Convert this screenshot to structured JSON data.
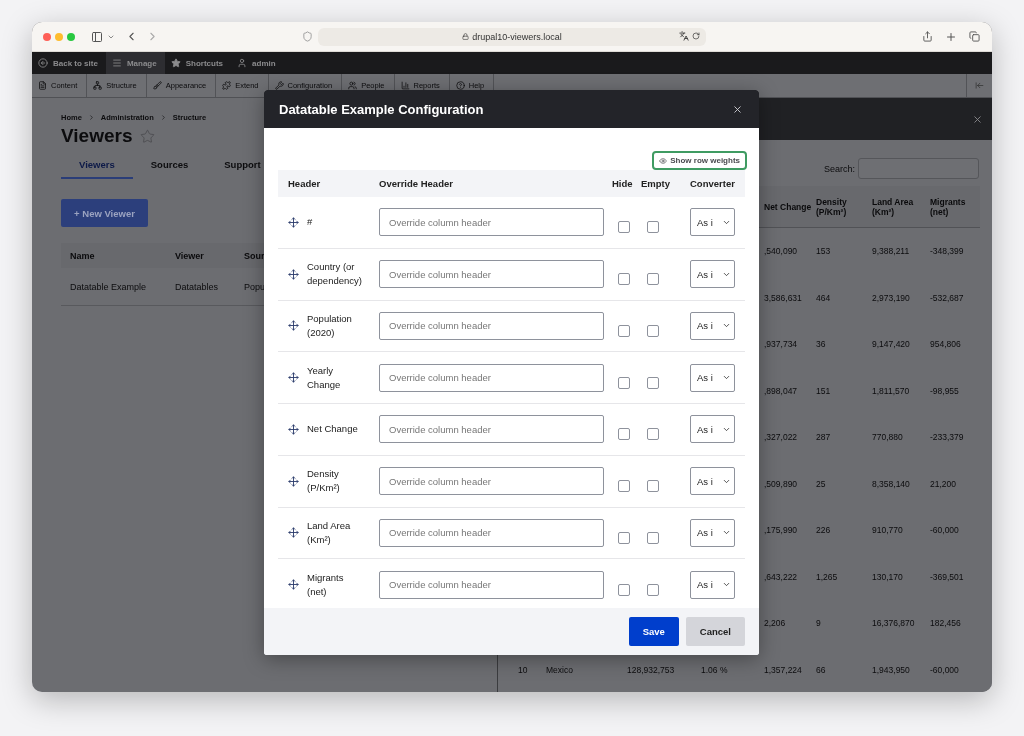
{
  "browser": {
    "url": "drupal10-viewers.local"
  },
  "admin_toolbar": {
    "items": [
      {
        "label": "Back to site",
        "kind": "back",
        "selected": false
      },
      {
        "label": "Manage",
        "kind": "menu",
        "selected": true
      },
      {
        "label": "Shortcuts",
        "kind": "star",
        "selected": false
      },
      {
        "label": "admin",
        "kind": "user",
        "selected": false
      }
    ]
  },
  "admin_menu": {
    "items": [
      {
        "label": "Content",
        "kind": "content"
      },
      {
        "label": "Structure",
        "kind": "structure"
      },
      {
        "label": "Appearance",
        "kind": "appearance"
      },
      {
        "label": "Extend",
        "kind": "extend"
      },
      {
        "label": "Configuration",
        "kind": "configuration"
      },
      {
        "label": "People",
        "kind": "people"
      },
      {
        "label": "Reports",
        "kind": "reports"
      },
      {
        "label": "Help",
        "kind": "help"
      }
    ]
  },
  "page": {
    "breadcrumb": [
      "Home",
      "Administration",
      "Structure"
    ],
    "title": "Viewers",
    "tabs": [
      {
        "label": "Viewers",
        "selected": true
      },
      {
        "label": "Sources",
        "selected": false
      },
      {
        "label": "Support",
        "selected": false
      }
    ],
    "new_button": "+ New Viewer",
    "table": {
      "columns": [
        "Name",
        "Viewer",
        "Sour"
      ],
      "rows": [
        [
          "Datatable Example",
          "Datatables",
          "Popu"
        ]
      ]
    }
  },
  "preview_dialog": {
    "search_label": "Search:",
    "columns": [
      "Net Change",
      "Density (P/Km²)",
      "Land Area (Km²)",
      "Migrants (net)"
    ],
    "rows": [
      {
        "net_change": ",540,090",
        "density": "153",
        "land_area": "9,388,211",
        "migrants": "-348,399"
      },
      {
        "net_change": "3,586,631",
        "density": "464",
        "land_area": "2,973,190",
        "migrants": "-532,687"
      },
      {
        "net_change": ",937,734",
        "density": "36",
        "land_area": "9,147,420",
        "migrants": "954,806"
      },
      {
        "net_change": ",898,047",
        "density": "151",
        "land_area": "1,811,570",
        "migrants": "-98,955"
      },
      {
        "net_change": ",327,022",
        "density": "287",
        "land_area": "770,880",
        "migrants": "-233,379"
      },
      {
        "net_change": ",509,890",
        "density": "25",
        "land_area": "8,358,140",
        "migrants": "21,200"
      },
      {
        "net_change": ",175,990",
        "density": "226",
        "land_area": "910,770",
        "migrants": "-60,000"
      },
      {
        "net_change": ",643,222",
        "density": "1,265",
        "land_area": "130,170",
        "migrants": "-369,501"
      },
      {
        "net_change": "2,206",
        "density": "9",
        "land_area": "16,376,870",
        "migrants": "182,456"
      },
      {
        "rank": "10",
        "country": "Mexico",
        "population": "128,932,753",
        "yearly_change": "1.06 %",
        "net_change": "1,357,224",
        "density": "66",
        "land_area": "1,943,950",
        "migrants": "-60,000"
      }
    ]
  },
  "config_dialog": {
    "title": "Datatable Example Configuration",
    "show_weights_button": "Show row weights",
    "columns": [
      "Header",
      "Override Header",
      "Hide",
      "Empty",
      "Converter"
    ],
    "rows": [
      {
        "header": "#",
        "placeholder": "Override column header",
        "hide": false,
        "empty": false,
        "converter": "As i"
      },
      {
        "header": "Country (or dependency)",
        "placeholder": "Override column header",
        "hide": false,
        "empty": false,
        "converter": "As i"
      },
      {
        "header": "Population (2020)",
        "placeholder": "Override column header",
        "hide": false,
        "empty": false,
        "converter": "As i"
      },
      {
        "header": "Yearly Change",
        "placeholder": "Override column header",
        "hide": false,
        "empty": false,
        "converter": "As i"
      },
      {
        "header": "Net Change",
        "placeholder": "Override column header",
        "hide": false,
        "empty": false,
        "converter": "As i"
      },
      {
        "header": "Density (P/Km²)",
        "placeholder": "Override column header",
        "hide": false,
        "empty": false,
        "converter": "As i"
      },
      {
        "header": "Land Area (Km²)",
        "placeholder": "Override column header",
        "hide": false,
        "empty": false,
        "converter": "As i"
      },
      {
        "header": "Migrants (net)",
        "placeholder": "Override column header",
        "hide": false,
        "empty": false,
        "converter": "As i"
      }
    ],
    "buttons": [
      {
        "label": "Save",
        "kind": "primary"
      },
      {
        "label": "Cancel",
        "kind": "secondary"
      }
    ]
  }
}
